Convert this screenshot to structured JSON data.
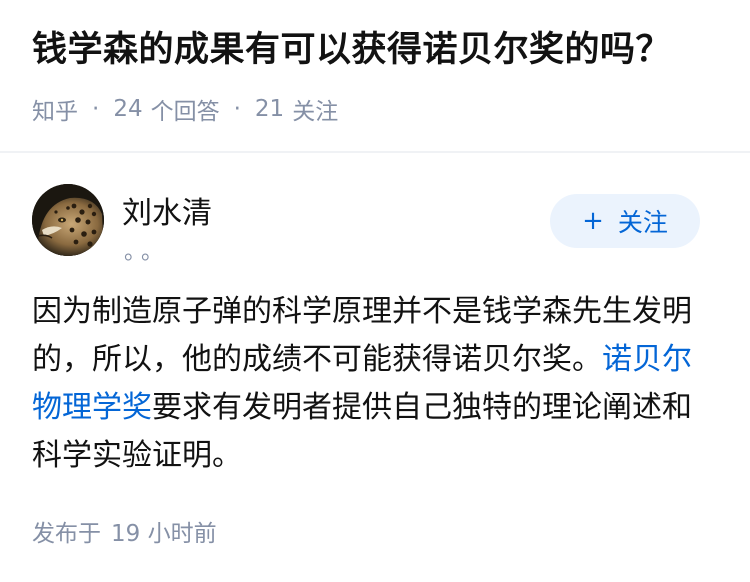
{
  "question": {
    "title": "钱学森的成果有可以获得诺贝尔奖的吗？",
    "source": "知乎",
    "answer_count": "24",
    "answer_label": "个回答",
    "follower_count": "21",
    "follower_label": "关注"
  },
  "author": {
    "name": "刘水清",
    "bio": "。。",
    "avatar_icon": "leopard-avatar",
    "follow_label": "关注",
    "follow_icon": "plus-icon"
  },
  "answer": {
    "text_before_link": "因为制造原子弹的科学原理并不是钱学森先生发明的，所以，他的成绩不可能获得诺贝尔奖。",
    "link_text": "诺贝尔物理学奖",
    "text_after_link": "要求有发明者提供自己独特的理论阐述和科学实验证明。"
  },
  "footer": {
    "publish_label": "发布于",
    "publish_time": "19 小时前"
  },
  "colors": {
    "accent": "#0466d6",
    "meta": "#8590a6",
    "follow_bg": "#ebf3fd",
    "divider": "#f0f2f5"
  }
}
